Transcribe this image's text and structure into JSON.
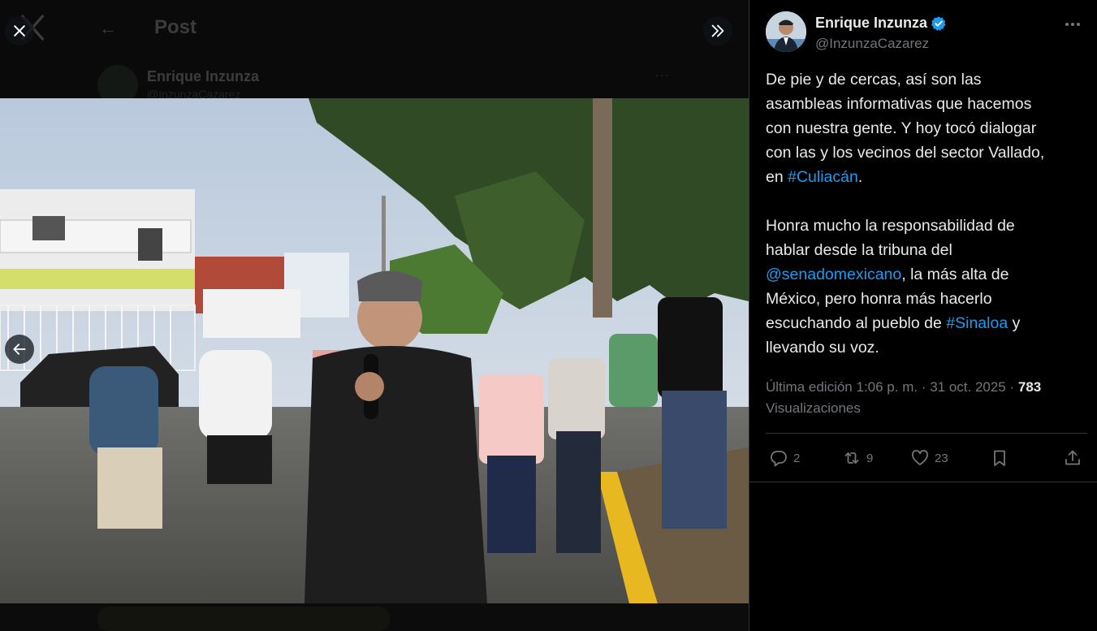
{
  "background": {
    "title": "Post",
    "author_name": "Enrique Inzunza",
    "author_handle": "@InzunzaCazarez"
  },
  "author": {
    "name": "Enrique Inzunza",
    "handle": "@InzunzaCazarez",
    "verified": true,
    "verified_color": "#1d9bf0"
  },
  "tweet": {
    "p1": {
      "l1": "De pie y de cercas, así son las",
      "l2": "asambleas informativas que hacemos",
      "l3": "con nuestra gente.  Y hoy tocó dialogar",
      "l4": "con las y los vecinos del sector Vallado,",
      "l5_prefix": "en ",
      "l5_link": "#Culiacán",
      "l5_suffix": "."
    },
    "p2": {
      "l1": "Honra mucho la responsabilidad de",
      "l2": "hablar desde la tribuna del",
      "l3_link": "@senadomexicano",
      "l3_suffix": ", la más alta de",
      "l4": "México, pero honra más hacerlo",
      "l5_prefix": "escuchando al pueblo de ",
      "l5_link": "#Sinaloa",
      "l5_suffix": " y",
      "l6": "llevando su voz."
    }
  },
  "meta": {
    "edited_prefix": "Última edición 1:06 p. m. · 31 oct. 2025 · ",
    "views": "783",
    "views_label": "Visualizaciones"
  },
  "actions": {
    "replies": "2",
    "reposts": "9",
    "likes": "23"
  },
  "colors": {
    "text": "#e7e9ea",
    "muted": "#71767b",
    "link": "#1d9bf0",
    "border": "#2f3336"
  },
  "icons": [
    "close-icon",
    "chevrons-right-icon",
    "arrow-left-icon",
    "verified-badge-icon",
    "more-icon",
    "reply-icon",
    "repost-icon",
    "like-icon",
    "bookmark-icon",
    "share-icon"
  ]
}
